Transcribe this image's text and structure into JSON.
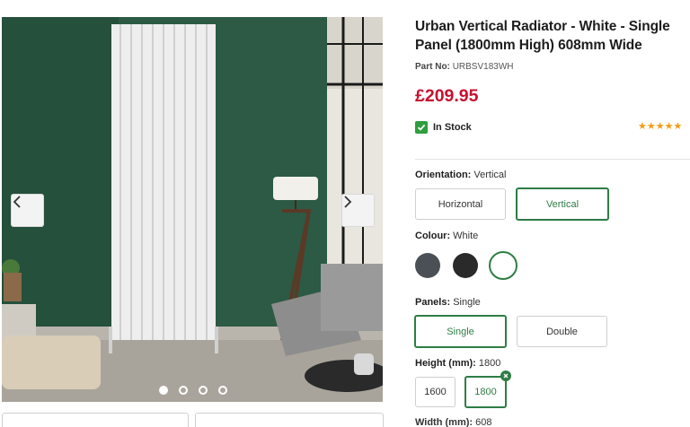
{
  "product": {
    "title": "Urban Vertical Radiator - White - Single Panel (1800mm High) 608mm Wide",
    "part_no_label": "Part No:",
    "part_no": "URBSV183WH",
    "price": "£209.95",
    "stock": "In Stock",
    "rating_stars": "★★★★★"
  },
  "gallery": {
    "slides": 4,
    "active_slide": 1
  },
  "options": {
    "orientation": {
      "label": "Orientation:",
      "value": "Vertical",
      "choices": [
        "Horizontal",
        "Vertical"
      ],
      "selected": "Vertical"
    },
    "colour": {
      "label": "Colour:",
      "value": "White",
      "swatches": [
        "#4a5056",
        "#2a2a2a",
        "#ffffff"
      ],
      "selected": "#ffffff"
    },
    "panels": {
      "label": "Panels:",
      "value": "Single",
      "choices": [
        "Single",
        "Double"
      ],
      "selected": "Single"
    },
    "height": {
      "label": "Height (mm):",
      "value": "1800",
      "choices": [
        "1600",
        "1800"
      ],
      "selected": "1800"
    },
    "width": {
      "label": "Width (mm):",
      "value": "608"
    }
  },
  "colors": {
    "accent": "#2e7d45",
    "price": "#c8102e",
    "stars": "#f39c12",
    "stock": "#2e9e3e"
  }
}
